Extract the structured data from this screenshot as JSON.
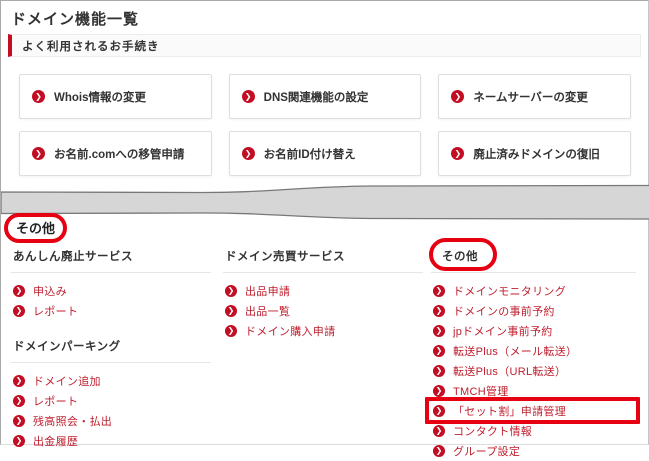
{
  "page": {
    "title": "ドメイン機能一覧",
    "quick_section_title": "よく利用されるお手続き",
    "others_heading": "その他"
  },
  "colors": {
    "accent_red": "#c30d23",
    "link_red": "#bf1e2e",
    "annotation_red": "#e60012",
    "divider_gray": "#d6d6d6",
    "heading_text": "#333333"
  },
  "icons": {
    "link_bullet": "chevron-circle-icon"
  },
  "quick_buttons": [
    {
      "label": "Whois情報の変更"
    },
    {
      "label": "DNS関連機能の設定"
    },
    {
      "label": "ネームサーバーの変更"
    },
    {
      "label": "お名前.comへの移管申請"
    },
    {
      "label": "お名前ID付け替え"
    },
    {
      "label": "廃止済みドメインの復旧"
    }
  ],
  "columns": [
    {
      "sections": [
        {
          "header": "あんしん廃止サービス",
          "links": [
            "申込み",
            "レポート"
          ]
        },
        {
          "header": "ドメインパーキング",
          "links": [
            "ドメイン追加",
            "レポート",
            "残高照会・払出",
            "出金履歴"
          ]
        }
      ]
    },
    {
      "sections": [
        {
          "header": "ドメイン売買サービス",
          "links": [
            "出品申請",
            "出品一覧",
            "ドメイン購入申請"
          ]
        }
      ]
    },
    {
      "sections": [
        {
          "header": "その他",
          "links": [
            "ドメインモニタリング",
            "ドメインの事前予約",
            "jpドメイン事前予約",
            "転送Plus（メール転送）",
            "転送Plus（URL転送）",
            "TMCH管理",
            "「セット割」申請管理",
            "コンタクト情報",
            "グループ設定"
          ]
        }
      ]
    }
  ]
}
